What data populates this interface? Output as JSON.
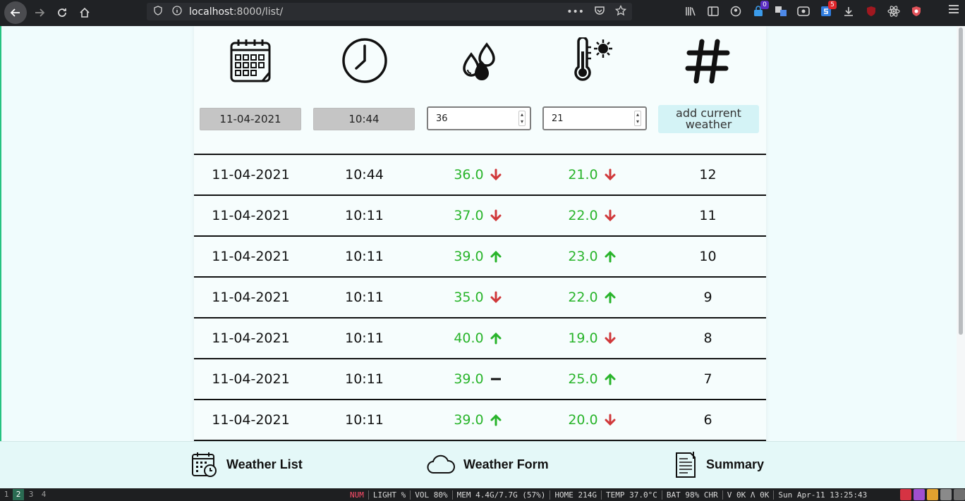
{
  "browser": {
    "url_host": "localhost",
    "url_path": ":8000/list/",
    "badges": {
      "ext1": "0",
      "ext2": "5"
    }
  },
  "form": {
    "date_value": "11-04-2021",
    "time_value": "10:44",
    "humidity_value": "36",
    "temperature_value": "21",
    "add_label_line1": "add current",
    "add_label_line2": "weather"
  },
  "table": {
    "rows": [
      {
        "date": "11-04-2021",
        "time": "10:44",
        "humidity": "36.0",
        "hum_trend": "down",
        "temp": "21.0",
        "temp_trend": "down",
        "id": "12"
      },
      {
        "date": "11-04-2021",
        "time": "10:11",
        "humidity": "37.0",
        "hum_trend": "down",
        "temp": "22.0",
        "temp_trend": "down",
        "id": "11"
      },
      {
        "date": "11-04-2021",
        "time": "10:11",
        "humidity": "39.0",
        "hum_trend": "up",
        "temp": "23.0",
        "temp_trend": "up",
        "id": "10"
      },
      {
        "date": "11-04-2021",
        "time": "10:11",
        "humidity": "35.0",
        "hum_trend": "down",
        "temp": "22.0",
        "temp_trend": "up",
        "id": "9"
      },
      {
        "date": "11-04-2021",
        "time": "10:11",
        "humidity": "40.0",
        "hum_trend": "up",
        "temp": "19.0",
        "temp_trend": "down",
        "id": "8"
      },
      {
        "date": "11-04-2021",
        "time": "10:11",
        "humidity": "39.0",
        "hum_trend": "same",
        "temp": "25.0",
        "temp_trend": "up",
        "id": "7"
      },
      {
        "date": "11-04-2021",
        "time": "10:11",
        "humidity": "39.0",
        "hum_trend": "up",
        "temp": "20.0",
        "temp_trend": "down",
        "id": "6"
      }
    ]
  },
  "nav": {
    "weather_list": "Weather List",
    "weather_form": "Weather Form",
    "summary": "Summary"
  },
  "status": {
    "workspaces": [
      "1",
      "2",
      "3",
      "4"
    ],
    "num": "NUM",
    "light": "LIGHT %",
    "vol": "VOL 80%",
    "mem": "MEM 4.4G/7.7G (57%)",
    "home": "HOME 214G",
    "temp": "TEMP 37.0°C",
    "bat": "BAT 98% CHR",
    "net": "V 0K Λ 0K",
    "clock": "Sun Apr-11 13:25:43"
  },
  "colors": {
    "trend_up": "#28b42a",
    "trend_down": "#d0383a",
    "value_green": "#28b42a"
  }
}
